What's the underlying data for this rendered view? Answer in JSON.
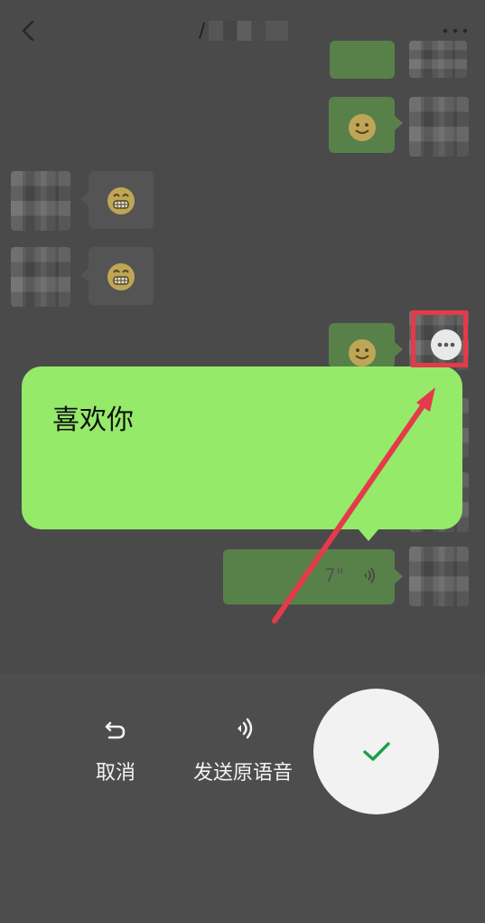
{
  "header": {
    "title_prefix": "/"
  },
  "transcription": {
    "text": "喜欢你"
  },
  "voice_message": {
    "duration": "7\""
  },
  "actions": {
    "cancel_label": "取消",
    "send_original_label": "发送原语音"
  },
  "colors": {
    "transcription_bg": "#95ea6a",
    "highlight": "#e53a4a",
    "confirm_check": "#19a04a",
    "overlay": "#4f4f4f",
    "panel": "#4d4d4d"
  },
  "icons": {
    "back": "back-arrow-icon",
    "more": "more-icon",
    "voice": "voice-icon",
    "cancel": "undo-icon",
    "send_original": "speaker-icon",
    "confirm": "check-icon"
  }
}
